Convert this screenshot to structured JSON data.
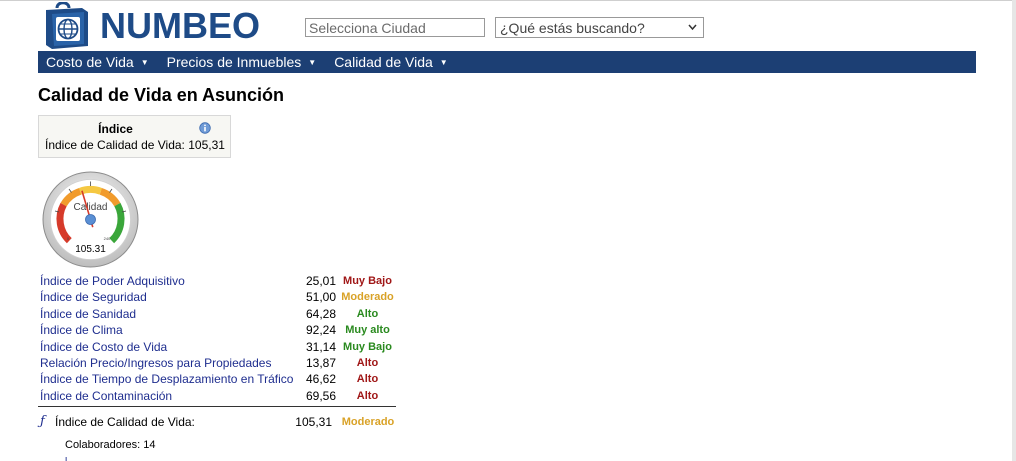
{
  "brand": {
    "name": "NUMBEO",
    "color": "#1e4b87"
  },
  "search": {
    "city_placeholder": "Selecciona Ciudad",
    "what_select_value": "¿Qué estás buscando?"
  },
  "nav": {
    "items": [
      {
        "label": "Costo de Vida"
      },
      {
        "label": "Precios de Inmuebles"
      },
      {
        "label": "Calidad de Vida"
      }
    ],
    "bg_color": "#1c3f74"
  },
  "page": {
    "title": "Calidad de Vida en Asunción"
  },
  "index_box": {
    "header": "Índice",
    "value_text": "Índice de Calidad de Vida: 105,31"
  },
  "gauge": {
    "label": "Calidad",
    "value_text": "105.31",
    "min_label": "0",
    "max_label": "240",
    "value": 105.31,
    "min": 0,
    "max": 240
  },
  "rows": [
    {
      "label": "Índice de Poder Adquisitivo",
      "value": "25,01",
      "rating": "Muy Bajo",
      "rating_color": "#a01717"
    },
    {
      "label": "Índice de Seguridad",
      "value": "51,00",
      "rating": "Moderado",
      "rating_color": "#d9a227"
    },
    {
      "label": "Índice de Sanidad",
      "value": "64,28",
      "rating": "Alto",
      "rating_color": "#2a8a1f"
    },
    {
      "label": "Índice de Clima",
      "value": "92,24",
      "rating": "Muy alto",
      "rating_color": "#2a8a1f"
    },
    {
      "label": "Índice de Costo de Vida",
      "value": "31,14",
      "rating": "Muy Bajo",
      "rating_color": "#2a8a1f"
    },
    {
      "label": "Relación Precio/Ingresos para Propiedades",
      "value": "13,87",
      "rating": "Alto",
      "rating_color": "#a01717"
    },
    {
      "label": "Índice de Tiempo de Desplazamiento en Tráfico",
      "value": "46,62",
      "rating": "Alto",
      "rating_color": "#a01717"
    },
    {
      "label": "Índice de Contaminación",
      "value": "69,56",
      "rating": "Alto",
      "rating_color": "#a01717"
    }
  ],
  "total": {
    "symbol": "ƒ",
    "label": "Índice de Calidad de Vida:",
    "value": "105,31",
    "rating": "Moderado",
    "rating_color": "#d9a227"
  },
  "contributors": {
    "text": "Colaboradores: 14"
  }
}
